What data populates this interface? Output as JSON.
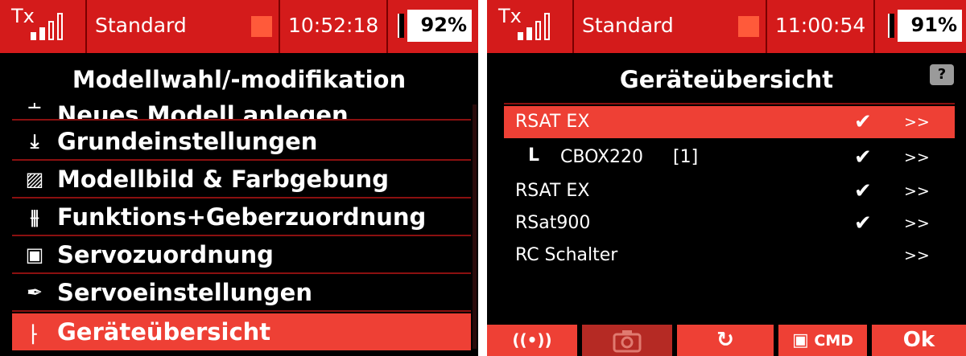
{
  "left_screen": {
    "status": {
      "tx_label": "Tx",
      "model_name": "Standard",
      "time": "10:52:18",
      "battery": "92%"
    },
    "title": "Modellwahl/-modifikation",
    "menu": [
      {
        "label": "Neues Modell anlegen",
        "icon": "new-model-icon",
        "glyph": "┴"
      },
      {
        "label": "Grundeinstellungen",
        "icon": "download-icon",
        "glyph": "⤓"
      },
      {
        "label": "Modellbild & Farbgebung",
        "icon": "image-icon",
        "glyph": "▨"
      },
      {
        "label": "Funktions+Geberzuordnung",
        "icon": "sliders-icon",
        "glyph": "⫵"
      },
      {
        "label": "Servozuordnung",
        "icon": "servo-icon",
        "glyph": "▣"
      },
      {
        "label": "Servoeinstellungen",
        "icon": "servo-arm-icon",
        "glyph": "✒"
      },
      {
        "label": "Geräteübersicht",
        "icon": "device-tree-icon",
        "glyph": "⸠",
        "selected": true
      }
    ]
  },
  "right_screen": {
    "status": {
      "tx_label": "Tx",
      "model_name": "Standard",
      "time": "11:00:54",
      "battery": "91%"
    },
    "title": "Geräteübersicht",
    "help_label": "?",
    "devices": [
      {
        "name": "RSAT EX",
        "child": false,
        "index": "",
        "checked": "✔",
        "arrow": ">>",
        "selected": true
      },
      {
        "name": "CBOX220",
        "child": true,
        "index": "[1]",
        "checked": "✔",
        "arrow": ">>"
      },
      {
        "name": "RSAT EX",
        "child": false,
        "index": "",
        "checked": "✔",
        "arrow": ">>"
      },
      {
        "name": "RSat900",
        "child": false,
        "index": "",
        "checked": "✔",
        "arrow": ">>"
      },
      {
        "name": "RC Schalter",
        "child": false,
        "index": "",
        "checked": "",
        "arrow": ">>"
      }
    ],
    "tree_marker": "L",
    "toolbar": {
      "wireless_icon": "((•))",
      "camera_icon": "camera-icon",
      "refresh_glyph": "↻",
      "cmd_label": "CMD",
      "ok_label": "Ok"
    }
  },
  "colors": {
    "status_bar": "#d41b1b",
    "selection": "#ee4035",
    "background": "#000000"
  }
}
